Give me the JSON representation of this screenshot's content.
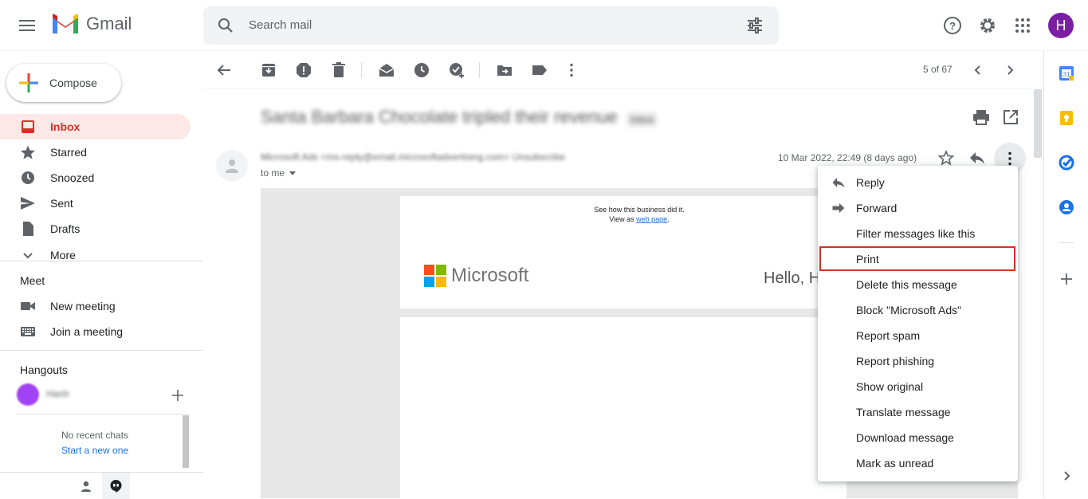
{
  "header": {
    "app_name": "Gmail",
    "search_placeholder": "Search mail",
    "avatar_initial": "H"
  },
  "compose": {
    "label": "Compose"
  },
  "nav": {
    "items": [
      {
        "label": "Inbox",
        "icon": "inbox-icon",
        "active": true
      },
      {
        "label": "Starred",
        "icon": "star-icon"
      },
      {
        "label": "Snoozed",
        "icon": "clock-icon"
      },
      {
        "label": "Sent",
        "icon": "send-icon"
      },
      {
        "label": "Drafts",
        "icon": "draft-icon"
      },
      {
        "label": "More",
        "icon": "chevron-down-icon"
      }
    ]
  },
  "meet": {
    "title": "Meet",
    "new_meeting": "New meeting",
    "join_meeting": "Join a meeting"
  },
  "hangouts": {
    "title": "Hangouts",
    "no_chats": "No recent chats",
    "start_new": "Start a new one"
  },
  "toolbar": {
    "pager": "5 of 67"
  },
  "message": {
    "subject": "Santa Barbara Chocolate tripled their revenue",
    "subject_badge": "Inbox",
    "sender_line": "Microsoft Ads <ms-reply@email.microsoftadvertising.com> Unsubscribe",
    "to_me": "to me",
    "date": "10 Mar 2022, 22:49 (8 days ago)"
  },
  "email_body": {
    "see_how": "See how this business did it.",
    "view_as": "View as",
    "web_page": "web page",
    "brand": "Microsoft",
    "greeting": "Hello, H"
  },
  "context_menu": {
    "items": [
      {
        "label": "Reply",
        "icon": "reply-icon"
      },
      {
        "label": "Forward",
        "icon": "forward-icon"
      },
      {
        "label": "Filter messages like this"
      },
      {
        "label": "Print",
        "highlighted": true
      },
      {
        "label": "Delete this message"
      },
      {
        "label": "Block \"Microsoft Ads\""
      },
      {
        "label": "Report spam"
      },
      {
        "label": "Report phishing"
      },
      {
        "label": "Show original"
      },
      {
        "label": "Translate message"
      },
      {
        "label": "Download message"
      },
      {
        "label": "Mark as unread"
      }
    ]
  },
  "colors": {
    "accent_red": "#d93025",
    "active_bg": "#fce8e6",
    "avatar_bg": "#7b1fa2",
    "link_blue": "#1a73e8"
  }
}
